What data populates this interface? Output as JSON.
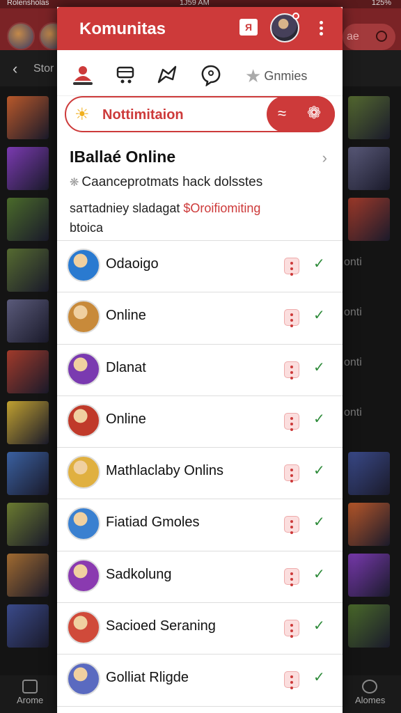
{
  "status_bar": {
    "left": "Rolensholas",
    "time": "1J59 AM",
    "battery": "125%"
  },
  "background": {
    "search_text": "ae",
    "back_label": "Stor",
    "side_texts": [
      "onti",
      "onti",
      "onti",
      "onti"
    ],
    "bottom_left_label": "Arome",
    "bottom_right_label": "Alomes",
    "tile_colors": [
      "#b8582a",
      "#7a3ab0",
      "#4a6a2a",
      "#556a30",
      "#5a5a7a",
      "#a03a2a",
      "#c0a030",
      "#3a60a0",
      "#6a7a30",
      "#a06a30",
      "#3a4a8a"
    ]
  },
  "panel": {
    "title": "Komunitas",
    "chat_label": "Я",
    "accent": "#cd3a3a",
    "tabs": [
      "people-tab",
      "shop-tab",
      "map-tab",
      "chat-tab"
    ],
    "games_tab": "Gnmies",
    "notification": {
      "label": "Nottimitaion"
    },
    "feature": {
      "heading": "IBallaé Online",
      "line1": "Caanceprotmats hack dolsstes",
      "line2_prefix": "saтtadniey sladagat ",
      "line2_highlight": "$Oroifiomiting",
      "line2_suffix": "btoica"
    },
    "items": [
      {
        "name": "Odaoigo",
        "avatar_color": "#2a7ad0",
        "status": "check"
      },
      {
        "name": "Online",
        "avatar_color": "#c88a3a",
        "status": "check"
      },
      {
        "name": "Dlanat",
        "avatar_color": "#7a3ab0",
        "status": "check"
      },
      {
        "name": "Online",
        "avatar_color": "#c03a2a",
        "status": "check"
      },
      {
        "name": "Mathlaclaby Onlins",
        "avatar_color": "#e0b040",
        "status": "check"
      },
      {
        "name": "Fiatiad Gmoles",
        "avatar_color": "#3a80d0",
        "status": "check"
      },
      {
        "name": "Sadkolung",
        "avatar_color": "#8a3ab0",
        "status": "check"
      },
      {
        "name": "Sacioed Seraning",
        "avatar_color": "#d04a3a",
        "status": "check"
      },
      {
        "name": "Golliat Rligde",
        "avatar_color": "#5a6ac0",
        "status": "check"
      }
    ]
  }
}
